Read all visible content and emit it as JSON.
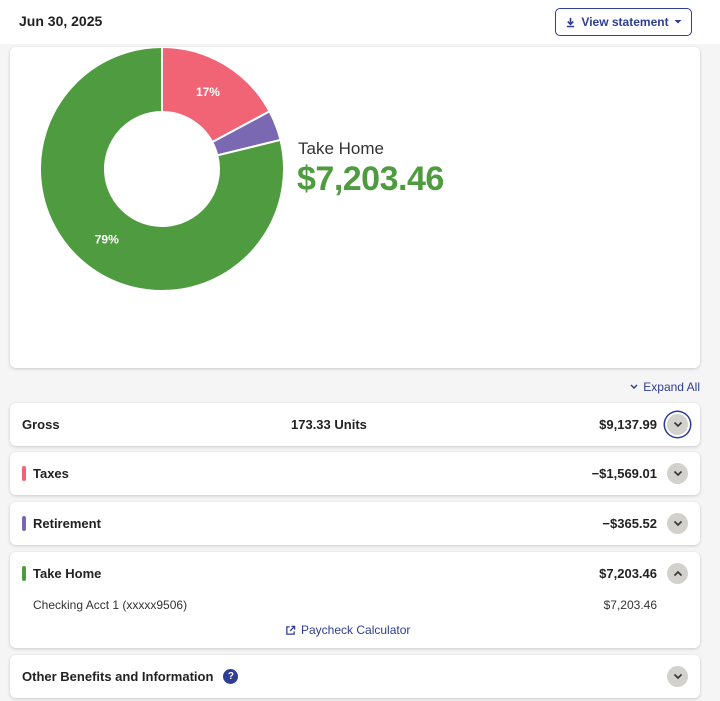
{
  "header": {
    "date": "Jun 30, 2025",
    "view_statement_label": "View statement",
    "icons": [
      "download-icon",
      "caret-down-icon"
    ]
  },
  "summary": {
    "take_home_label": "Take Home",
    "take_home_value": "$7,203.46",
    "colors": {
      "taxes": "#f06475",
      "retirement": "#7b68b3",
      "take_home": "#4f9b3f"
    },
    "chart_data": {
      "type": "pie",
      "style": "donut",
      "labels": [
        "Taxes",
        "Retirement",
        "Take Home"
      ],
      "values": [
        1569.01,
        365.52,
        7203.46
      ],
      "percent_labels": [
        "17%",
        "",
        "79%"
      ]
    }
  },
  "expand_all_label": "Expand All",
  "rows": {
    "gross": {
      "label": "Gross",
      "units": "173.33 Units",
      "amount": "$9,137.99"
    },
    "taxes": {
      "label": "Taxes",
      "amount": "−$1,569.01"
    },
    "retirement": {
      "label": "Retirement",
      "amount": "−$365.52"
    },
    "take_home": {
      "label": "Take Home",
      "amount": "$7,203.46",
      "account_label": "Checking Acct 1 (xxxxx9506)",
      "account_amount": "$7,203.46",
      "calculator_label": "Paycheck Calculator"
    },
    "other": {
      "label": "Other Benefits and Information",
      "help_glyph": "?"
    }
  }
}
